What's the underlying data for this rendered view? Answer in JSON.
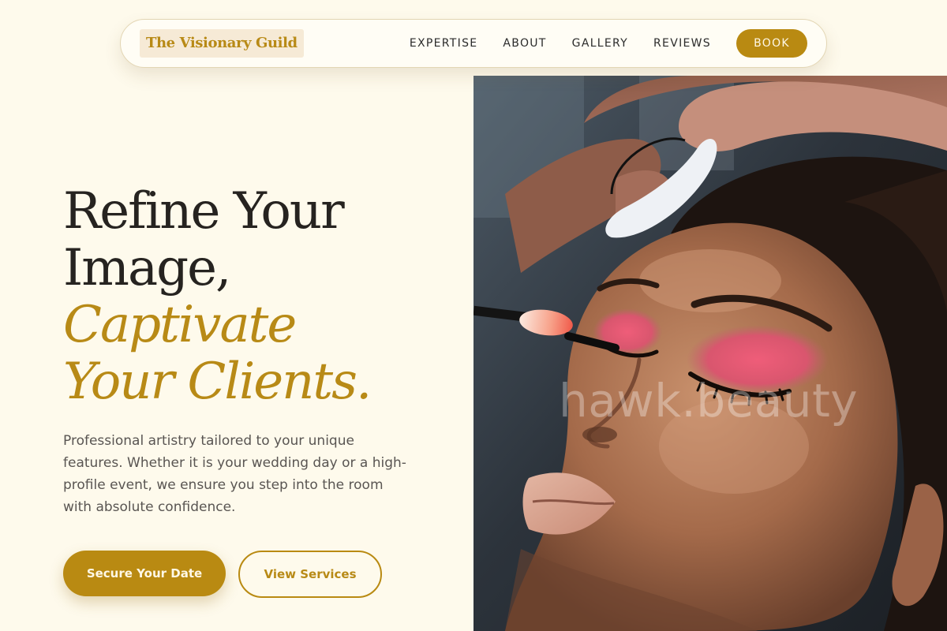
{
  "brand": {
    "name": "The Visionary Guild",
    "accent_color": "#b98a12",
    "background_color": "#fefaec"
  },
  "nav": {
    "links": [
      {
        "label": "EXPERTISE"
      },
      {
        "label": "ABOUT"
      },
      {
        "label": "GALLERY"
      },
      {
        "label": "REVIEWS"
      }
    ],
    "cta_label": "BOOK"
  },
  "hero": {
    "headline": {
      "line1": "Refine Your",
      "line2": "Image,",
      "accent1": "Captivate",
      "accent2": "Your Clients."
    },
    "description": "Professional artistry tailored to your unique features. Whether it is your wedding day or a high-profile event, we ensure you step into the room with absolute confidence.",
    "primary_cta": "Secure Your Date",
    "secondary_cta": "View Services",
    "image": {
      "subject": "makeup-application-photo",
      "watermark": "hawk.beauty"
    }
  }
}
